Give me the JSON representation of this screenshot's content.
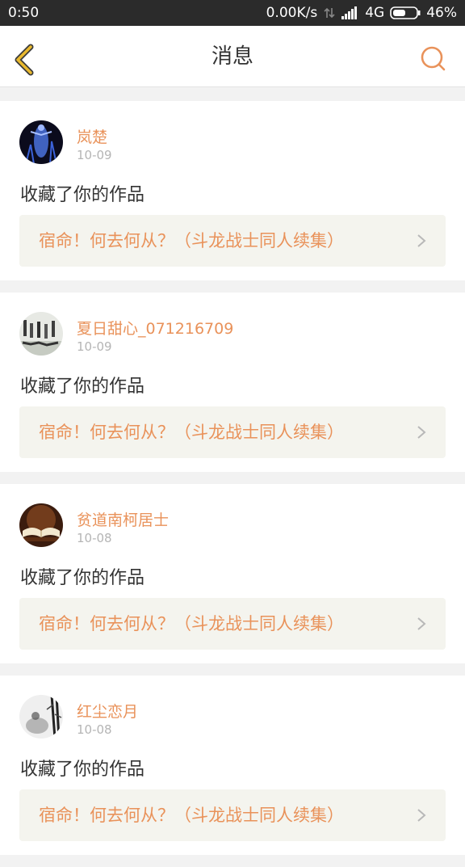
{
  "status": {
    "time": "0:50",
    "speed": "0.00K/s",
    "network": "4G",
    "battery": "46%"
  },
  "header": {
    "title": "消息",
    "back_icon": "chevron-left-icon",
    "search_icon": "search-icon"
  },
  "colors": {
    "accent": "#e9925a",
    "back_icon": "#e9b92e",
    "card_link_bg": "#f4f4ee"
  },
  "messages": [
    {
      "username": "岚楚",
      "date": "10-09",
      "action": "收藏了你的作品",
      "work_title": "宿命！何去何从？（斗龙战士同人续集）"
    },
    {
      "username": "夏日甜心_071216709",
      "date": "10-09",
      "action": "收藏了你的作品",
      "work_title": "宿命！何去何从？（斗龙战士同人续集）"
    },
    {
      "username": "贫道南柯居士",
      "date": "10-08",
      "action": "收藏了你的作品",
      "work_title": "宿命！何去何从？（斗龙战士同人续集）"
    },
    {
      "username": "红尘恋月",
      "date": "10-08",
      "action": "收藏了你的作品",
      "work_title": "宿命！何去何从？（斗龙战士同人续集）"
    }
  ]
}
